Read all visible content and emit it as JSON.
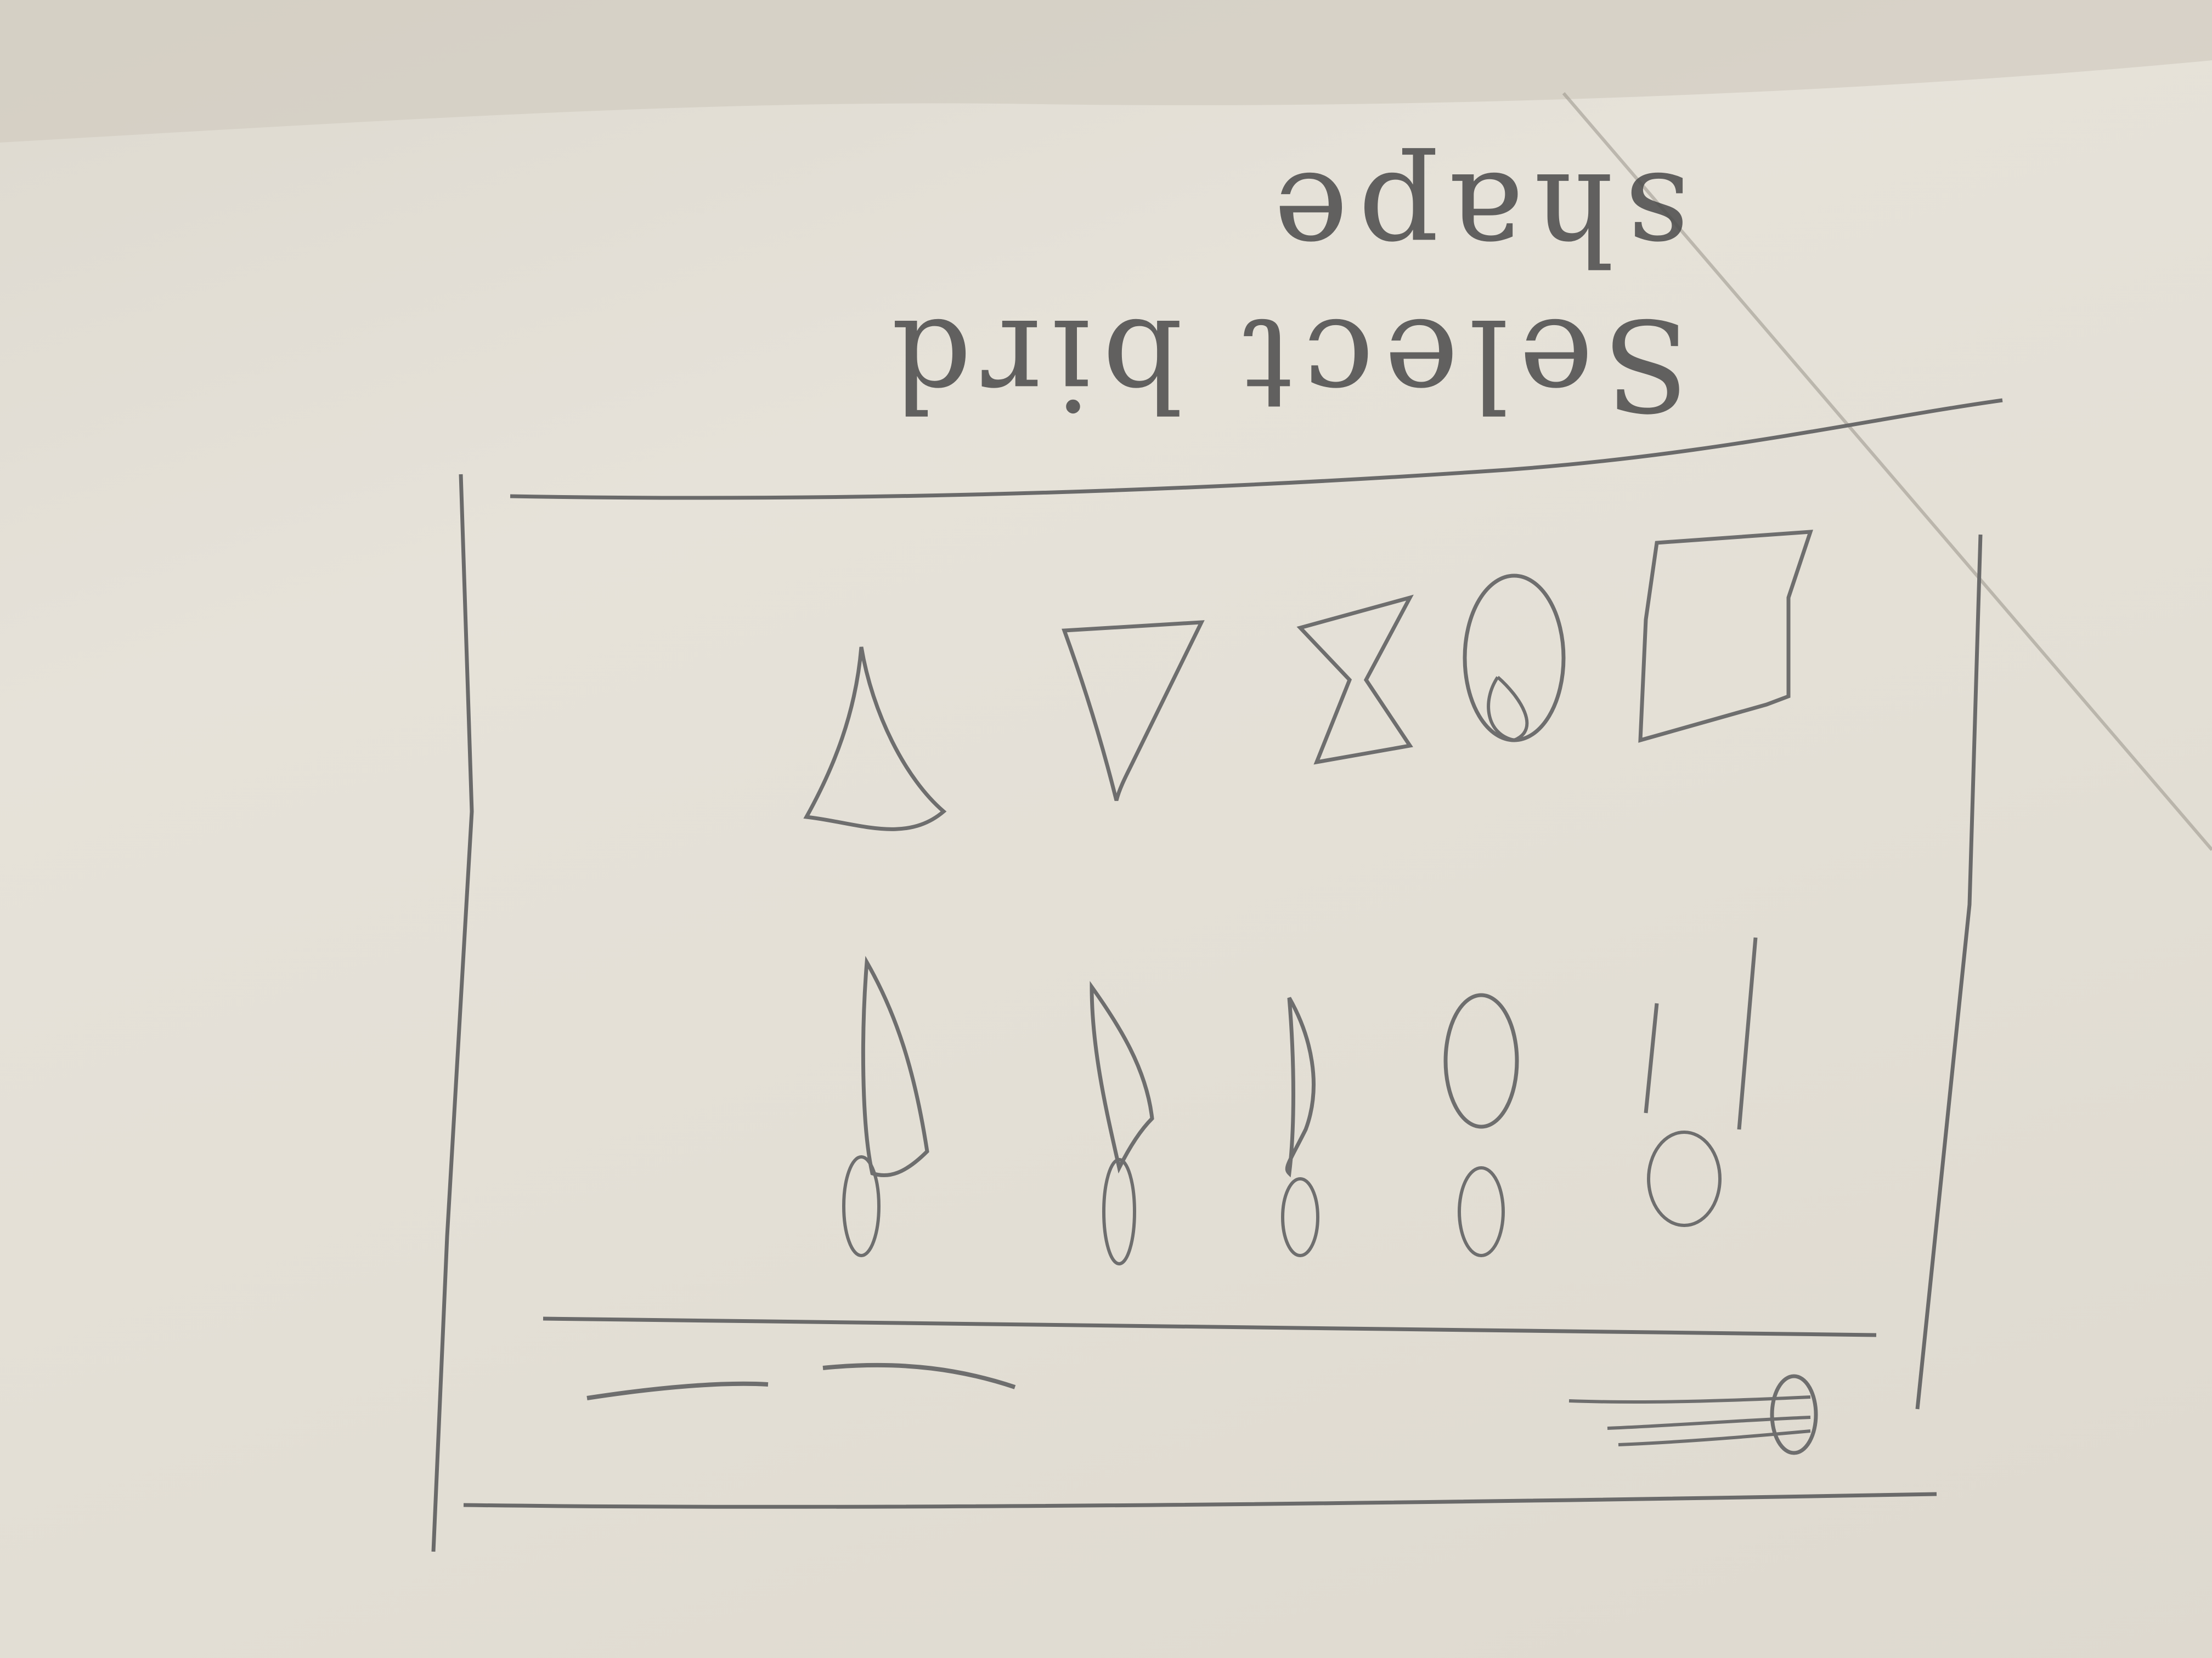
{
  "header": {
    "title": "Select bird shape"
  },
  "colors": {
    "paper": "#e4e0d7",
    "pencil": "#6e6e6e",
    "shadow": "#c9c4b8"
  },
  "shape_grid": {
    "rows": 2,
    "columns": 5,
    "icons": [
      "triangle-icon",
      "inverted-triangle-icon",
      "hourglass-icon",
      "oval-icon",
      "square-icon",
      "tall-triangle-icon",
      "curved-leaf-icon",
      "pointed-leaf-icon",
      "ellipse-icon",
      "stick-icon"
    ]
  },
  "footer": {
    "left_icons": [
      "line-placeholder-icon",
      "line-placeholder-icon"
    ],
    "right_icon": "circle-control-icon"
  }
}
